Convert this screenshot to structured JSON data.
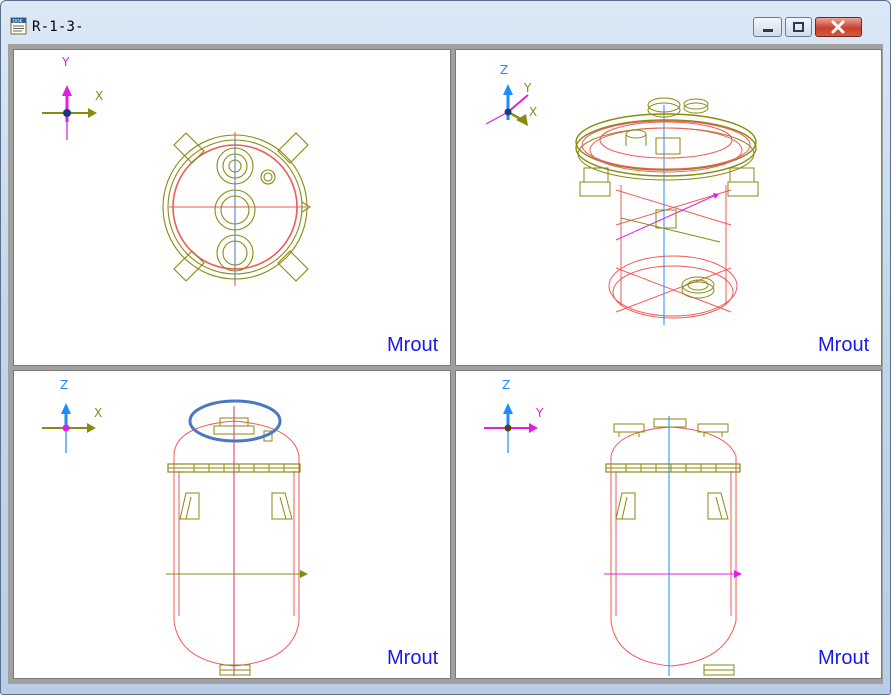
{
  "window": {
    "title": "R-1-3-",
    "app_icon": "document-icon",
    "controls": [
      "minimize-icon",
      "maximize-icon",
      "close-icon"
    ]
  },
  "viewports": [
    {
      "id": "top-view",
      "axes": {
        "vertical": "Y",
        "horizontal": "X"
      },
      "label": "Mrout"
    },
    {
      "id": "iso-view",
      "axes": {
        "vertical": "Z",
        "horizontal": "Y",
        "third": "X"
      },
      "label": "Mrout"
    },
    {
      "id": "front-view",
      "axes": {
        "vertical": "Z",
        "horizontal": "X"
      },
      "label": "Mrout"
    },
    {
      "id": "side-view",
      "axes": {
        "vertical": "Z",
        "horizontal": "Y"
      },
      "label": "Mrout"
    }
  ],
  "colors": {
    "wireframe_red": "#f05a5a",
    "wireframe_olive": "#8a8a10",
    "axis_magenta": "#e020e0",
    "axis_blue": "#1e8cff",
    "label_blue": "#1a1ae6",
    "highlight_ellipse": "#4a78c0"
  }
}
